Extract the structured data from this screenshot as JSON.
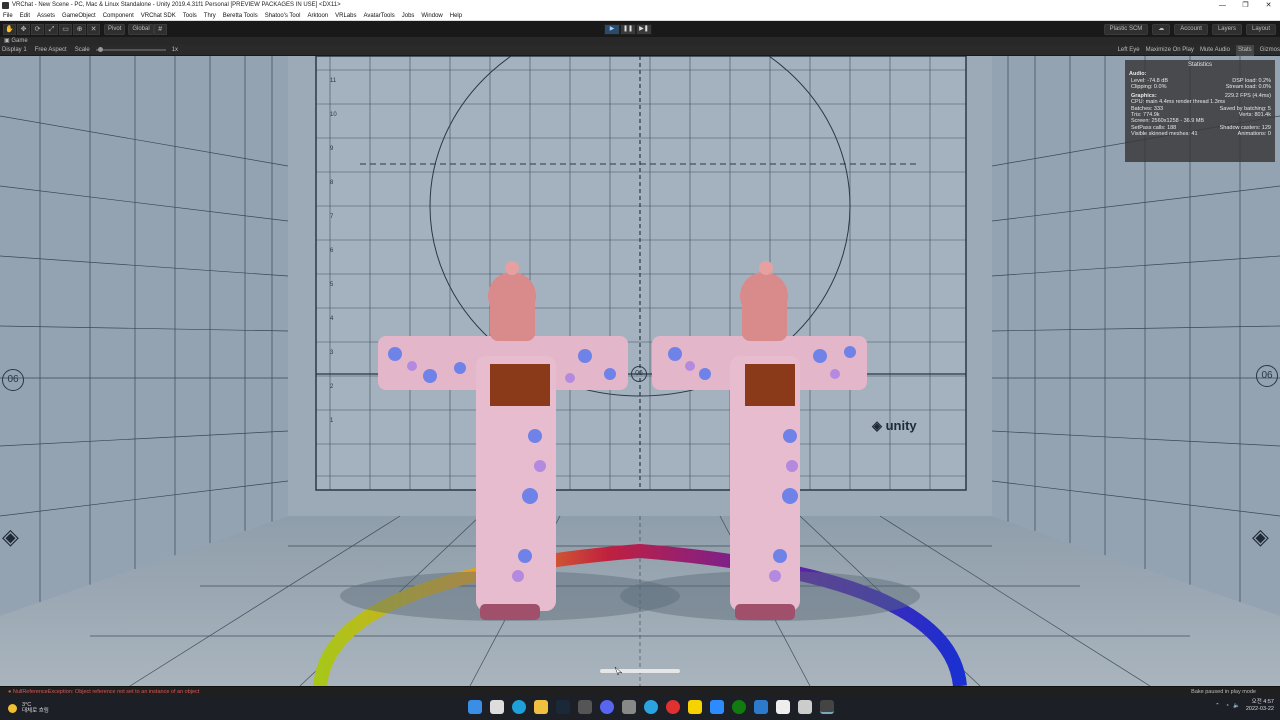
{
  "window": {
    "title": "VRChat - New Scene - PC, Mac & Linux Standalone - Unity 2019.4.31f1 Personal [PREVIEW PACKAGES IN USE] <DX11>",
    "controls": [
      "—",
      "❐",
      "✕"
    ]
  },
  "menu": [
    "File",
    "Edit",
    "Assets",
    "GameObject",
    "Component",
    "VRChat SDK",
    "Tools",
    "Thry",
    "Beretta Tools",
    "Shatoo's Tool",
    "Arktoon",
    "VRLabs",
    "AvatarTools",
    "Jobs",
    "Window",
    "Help"
  ],
  "toolbar": {
    "tools": [
      "✋",
      "✥",
      "⟳",
      "⤢",
      "▭",
      "⊕",
      "✕"
    ],
    "pivot": "Pivot",
    "global": "Global",
    "play": "▶",
    "pause": "❚❚",
    "step": "▶❚",
    "plastic": "Plastic SCM",
    "cloud": "☁",
    "account": "Account",
    "layers": "Layers",
    "layout": "Layout"
  },
  "tab": {
    "label": "Game"
  },
  "gamebar": {
    "display": "Display 1",
    "aspect": "Free Aspect",
    "scale_label": "Scale",
    "scale_value": "1x",
    "eye": "Left Eye",
    "maximize": "Maximize On Play",
    "mute": "Mute Audio",
    "stats": "Stats",
    "gizmos": "Gizmos"
  },
  "stats": {
    "title": "Statistics",
    "audio_label": "Audio:",
    "level": "Level: -74.8 dB",
    "dsp": "DSP load: 0.2%",
    "clipping": "Clipping: 0.0%",
    "stream": "Stream load: 0.0%",
    "graphics_label": "Graphics:",
    "fps": "229.2 FPS (4.4ms)",
    "cpu": "CPU: main 4.4ms  render thread 1.3ms",
    "batches": "Batches: 333",
    "saved": "Saved by batching: 5",
    "tris": "Tris: 774.9k",
    "verts": "Verts: 801.4k",
    "screen": "Screen: 2560x1258 - 36.9 MB",
    "setpass": "SetPass calls: 188",
    "shadow": "Shadow casters: 129",
    "skinned": "Visible skinned meshes: 41",
    "animations": "Animations: 0"
  },
  "scene": {
    "brand": "unity",
    "marker_left": "06",
    "marker_right": "06",
    "marker_center": "06",
    "tick_labels": [
      "11",
      "10",
      "9",
      "8",
      "7",
      "6",
      "5",
      "4",
      "3",
      "2",
      "1"
    ]
  },
  "status": {
    "error": "NullReferenceException: Object reference not set to an instance of an object",
    "bake": "Bake paused in play mode"
  },
  "taskbar": {
    "temp": "3°C",
    "weather": "대체로 흐림",
    "time": "오전 4:57",
    "date": "2022-03-22"
  },
  "colors": {
    "accent_play": "#2b4b6b",
    "viewport_bg": "#9aa9b8",
    "grid_line": "#2b3745",
    "kimono": "#e8b8cc",
    "hair": "#d98a8a"
  }
}
